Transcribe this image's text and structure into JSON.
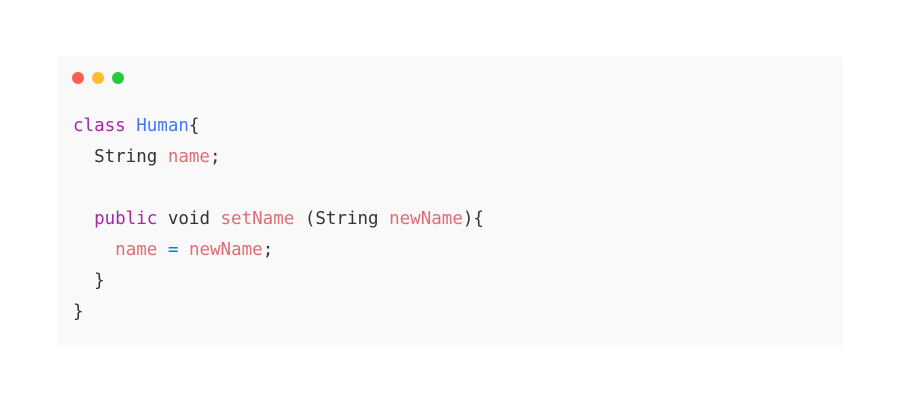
{
  "window_controls": {
    "close": {
      "color": "#ff5f56",
      "icon": "close-dot-icon"
    },
    "minimize": {
      "color": "#ffbd2e",
      "icon": "minimize-dot-icon"
    },
    "maximize": {
      "color": "#27c93f",
      "icon": "maximize-dot-icon"
    }
  },
  "colors": {
    "keyword": "#a626a4",
    "class_name": "#4078f2",
    "identifier": "#e06c75",
    "operator": "#0184bc",
    "plain": "#333333",
    "background": "#f9f9f9"
  },
  "code": {
    "lines": [
      {
        "tokens": [
          {
            "text": "class",
            "kind": "keyword"
          },
          {
            "text": " ",
            "kind": "plain"
          },
          {
            "text": "Human",
            "kind": "class_name"
          },
          {
            "text": "{",
            "kind": "plain"
          }
        ]
      },
      {
        "tokens": [
          {
            "text": "  String ",
            "kind": "plain"
          },
          {
            "text": "name",
            "kind": "identifier"
          },
          {
            "text": ";",
            "kind": "plain"
          }
        ]
      },
      {
        "tokens": []
      },
      {
        "tokens": [
          {
            "text": "  ",
            "kind": "plain"
          },
          {
            "text": "public",
            "kind": "keyword"
          },
          {
            "text": " void ",
            "kind": "plain"
          },
          {
            "text": "setName",
            "kind": "identifier"
          },
          {
            "text": " (String ",
            "kind": "plain"
          },
          {
            "text": "newName",
            "kind": "identifier"
          },
          {
            "text": "){",
            "kind": "plain"
          }
        ]
      },
      {
        "tokens": [
          {
            "text": "    ",
            "kind": "plain"
          },
          {
            "text": "name",
            "kind": "identifier"
          },
          {
            "text": " ",
            "kind": "plain"
          },
          {
            "text": "=",
            "kind": "operator"
          },
          {
            "text": " ",
            "kind": "plain"
          },
          {
            "text": "newName",
            "kind": "identifier"
          },
          {
            "text": ";",
            "kind": "plain"
          }
        ]
      },
      {
        "tokens": [
          {
            "text": "  }",
            "kind": "plain"
          }
        ]
      },
      {
        "tokens": [
          {
            "text": "}",
            "kind": "plain"
          }
        ]
      }
    ]
  }
}
